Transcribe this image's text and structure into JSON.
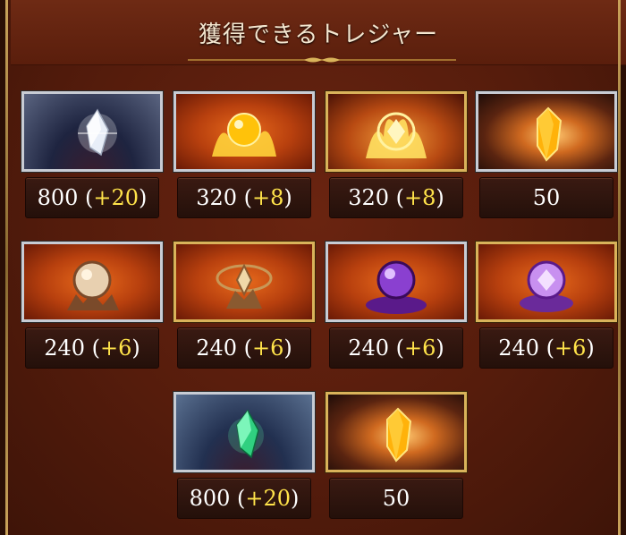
{
  "header": {
    "title": "獲得できるトレジャー"
  },
  "colors": {
    "bonus": "#ffe34a",
    "frame_silver": "#c8ccd4",
    "frame_gold": "#d9b35a"
  },
  "treasures": [
    {
      "icon": "white-crystal-icon",
      "frame": "silver",
      "amount": "800",
      "bonus": "20"
    },
    {
      "icon": "golden-flame-orb-icon",
      "frame": "silver",
      "amount": "320",
      "bonus": "8"
    },
    {
      "icon": "golden-flame-sigil-icon",
      "frame": "gold",
      "amount": "320",
      "bonus": "8"
    },
    {
      "icon": "gold-gem-icon",
      "frame": "silver",
      "amount": "50",
      "bonus": ""
    },
    {
      "icon": "earth-orb-icon",
      "frame": "silver",
      "amount": "240",
      "bonus": "6"
    },
    {
      "icon": "earth-sigil-icon",
      "frame": "gold",
      "amount": "240",
      "bonus": "6"
    },
    {
      "icon": "dark-orb-icon",
      "frame": "silver",
      "amount": "240",
      "bonus": "6"
    },
    {
      "icon": "dark-sigil-icon",
      "frame": "gold",
      "amount": "240",
      "bonus": "6"
    },
    {
      "icon": "green-crystal-icon",
      "frame": "silver",
      "amount": "800",
      "bonus": "20"
    },
    {
      "icon": "gold-gem-icon",
      "frame": "gold",
      "amount": "50",
      "bonus": ""
    }
  ]
}
